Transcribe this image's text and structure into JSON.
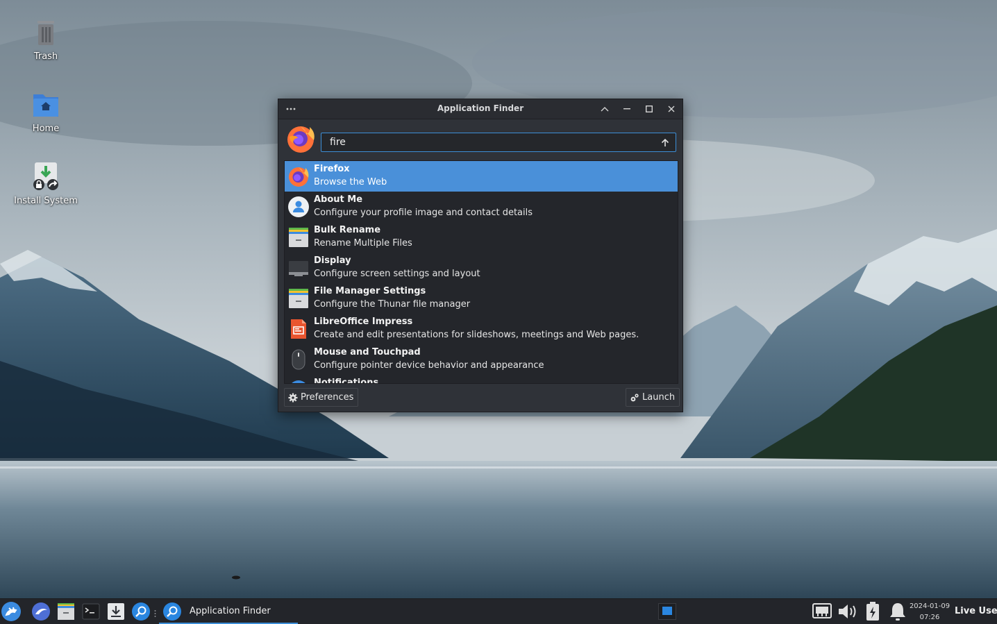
{
  "desktop": {
    "icons": [
      {
        "label": "Trash",
        "icon": "trash-icon"
      },
      {
        "label": "Home",
        "icon": "home-folder-icon"
      },
      {
        "label": "Install System",
        "icon": "install-system-icon"
      }
    ]
  },
  "window": {
    "title": "Application Finder",
    "menu_icon": "dots-menu-icon",
    "controls": [
      "collapse-icon",
      "minimize-icon",
      "maximize-icon",
      "close-icon"
    ],
    "search": {
      "value": "fire",
      "icon": "firefox-icon"
    },
    "results": [
      {
        "name": "Firefox",
        "description": "Browse the Web",
        "icon": "firefox-icon",
        "selected": true
      },
      {
        "name": "About Me",
        "description": "Configure your profile image and contact details",
        "icon": "user-profile-icon",
        "selected": false
      },
      {
        "name": "Bulk Rename",
        "description": "Rename Multiple Files",
        "icon": "file-cabinet-icon",
        "selected": false
      },
      {
        "name": "Display",
        "description": "Configure screen settings and layout",
        "icon": "display-icon",
        "selected": false
      },
      {
        "name": "File Manager Settings",
        "description": "Configure the Thunar file manager",
        "icon": "file-cabinet-icon",
        "selected": false
      },
      {
        "name": "LibreOffice Impress",
        "description": "Create and edit presentations for slideshows, meetings and Web pages.",
        "icon": "libreoffice-impress-icon",
        "selected": false
      },
      {
        "name": "Mouse and Touchpad",
        "description": "Configure pointer device behavior and appearance",
        "icon": "mouse-icon",
        "selected": false
      },
      {
        "name": "Notifications",
        "description": "",
        "icon": "notifications-icon",
        "selected": false
      }
    ],
    "footer": {
      "preferences_label": "Preferences",
      "launch_label": "Launch"
    }
  },
  "taskbar": {
    "launchers": [
      "whisker-menu-icon",
      "web-browser-icon",
      "file-manager-icon",
      "terminal-icon",
      "installer-icon",
      "app-finder-icon"
    ],
    "task": {
      "label": "Application Finder",
      "icon": "app-finder-icon"
    },
    "tray": [
      "network-icon",
      "volume-icon",
      "power-icon",
      "notification-bell-icon"
    ],
    "clock": {
      "date": "2024-01-09",
      "time": "07:26"
    },
    "user": "Live User"
  },
  "colors": {
    "accent": "#4a90d9",
    "window_bg": "#2f3238",
    "taskbar_bg": "#23252a"
  }
}
